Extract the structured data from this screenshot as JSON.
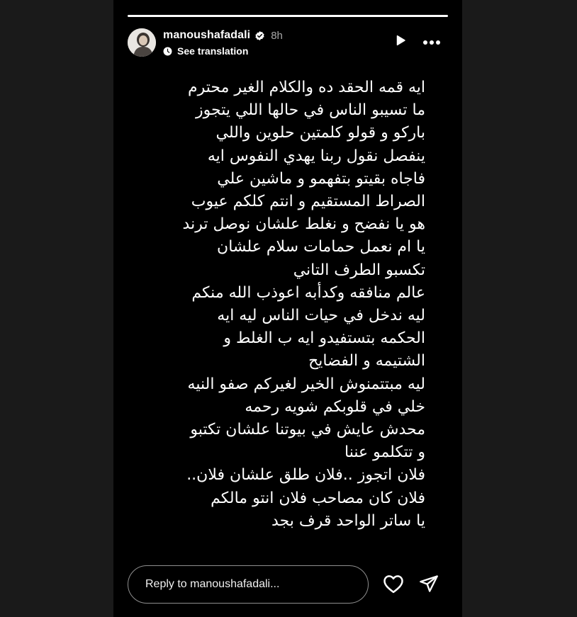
{
  "story": {
    "progress": 1.0,
    "user": {
      "username": "manoushafadali",
      "time": "8h",
      "verified": true,
      "avatar_icon": "avatar-photo"
    },
    "see_translation": "See translation",
    "controls": {
      "play_icon": "play-icon",
      "more_icon": "more-icon"
    },
    "text_lines": [
      "ايه قمه الحقد ده والكلام الغير محترم",
      "ما تسيبو الناس في حالها اللي يتجوز",
      "باركو و قولو كلمتين حلوين واللي",
      "ينفصل نقول ربنا يهدي النفوس ايه",
      "فاجاه بقيتو بتفهمو و ماشين علي",
      "الصراط المستقيم و انتم كلكم عيوب",
      "هو يا نفضح و نغلط علشان نوصل ترند",
      "يا ام نعمل حمامات سلام علشان",
      "تكسبو الطرف التاني",
      "عالم منافقه وكدأبه اعوذب الله منكم",
      "ليه ندخل في حيات الناس ليه ايه",
      "الحكمه بتستفيدو ايه ب الغلط و",
      "الشتيمه و الفضايح",
      "ليه مبتتمنوش الخير لغيركم صفو النيه",
      "خلي في قلوبكم شويه رحمه",
      "محدش عايش في بيوتنا علشان تكتبو",
      "و تتكلمو عننا",
      "فلان اتجوز ..فلان طلق علشان فلان..",
      "فلان كان مصاحب فلان  انتو مالكم",
      "يا ساتر الواحد قرف بجد"
    ],
    "reply": {
      "placeholder": "Reply to manoushafadali..."
    },
    "footer_icons": {
      "like": "heart-icon",
      "share": "send-icon"
    }
  }
}
